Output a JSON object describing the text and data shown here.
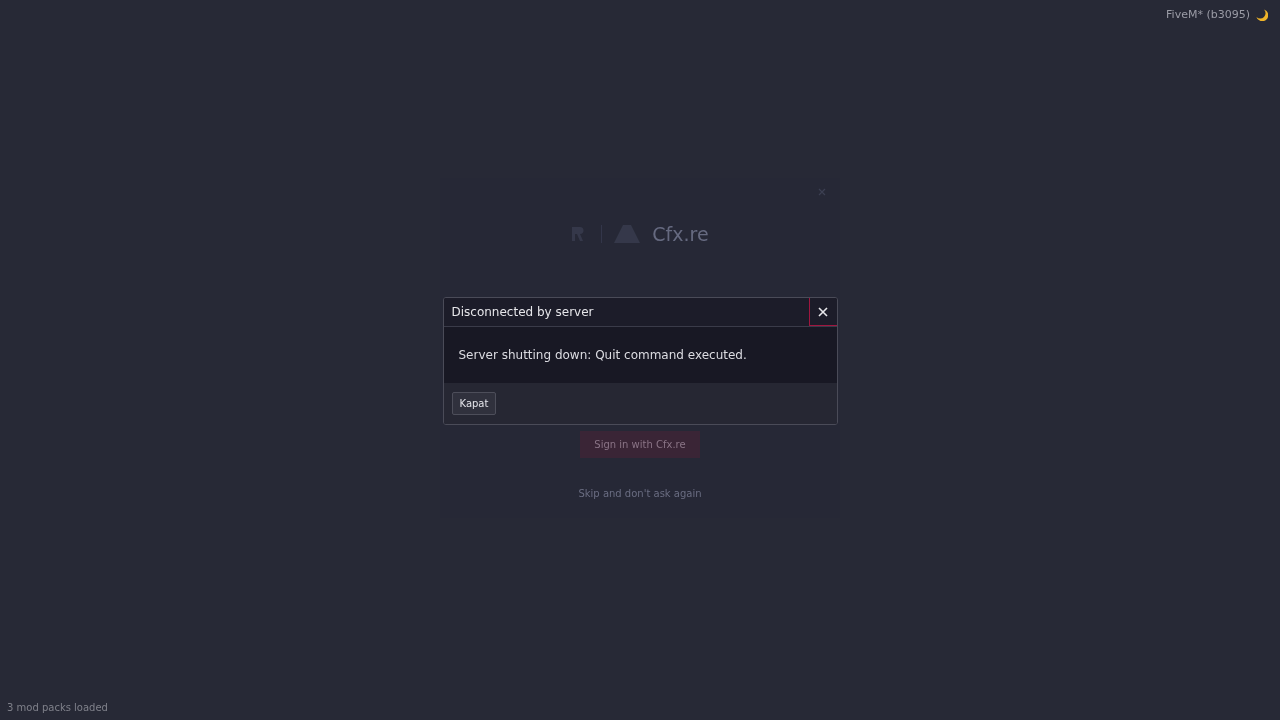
{
  "status": {
    "version": "FiveM* (b3095)"
  },
  "background": {
    "brand": "Cfx.re",
    "sign_in_button": "Sign in with Cfx.re",
    "skip_link": "Skip and don't ask again"
  },
  "dialog": {
    "title": "Disconnected by server",
    "message": "Server shutting down: Quit command executed.",
    "close_focused": true,
    "buttons": [
      "Kapat"
    ]
  },
  "footer": {
    "mod_packs": "3 mod packs loaded"
  }
}
